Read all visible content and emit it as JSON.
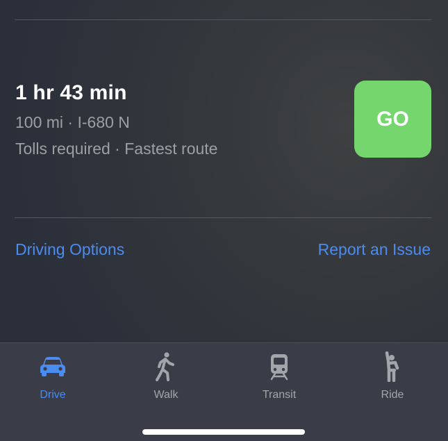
{
  "route": {
    "duration": "1 hr 43 min",
    "distance_line": "100 mi · I-680 N",
    "details_line": "Tolls required · Fastest route"
  },
  "go_button": {
    "label": "GO"
  },
  "links": {
    "driving_options": "Driving Options",
    "report_issue": "Report an Issue"
  },
  "tabs": [
    {
      "label": "Drive",
      "icon": "car-icon",
      "active": true
    },
    {
      "label": "Walk",
      "icon": "walk-icon",
      "active": false
    },
    {
      "label": "Transit",
      "icon": "train-icon",
      "active": false
    },
    {
      "label": "Ride",
      "icon": "ride-icon",
      "active": false
    }
  ],
  "colors": {
    "accent": "#4a8cf0",
    "go": "#75d66e",
    "secondary_text": "#9d9fa3",
    "inactive_icon": "#a3a5aa"
  }
}
